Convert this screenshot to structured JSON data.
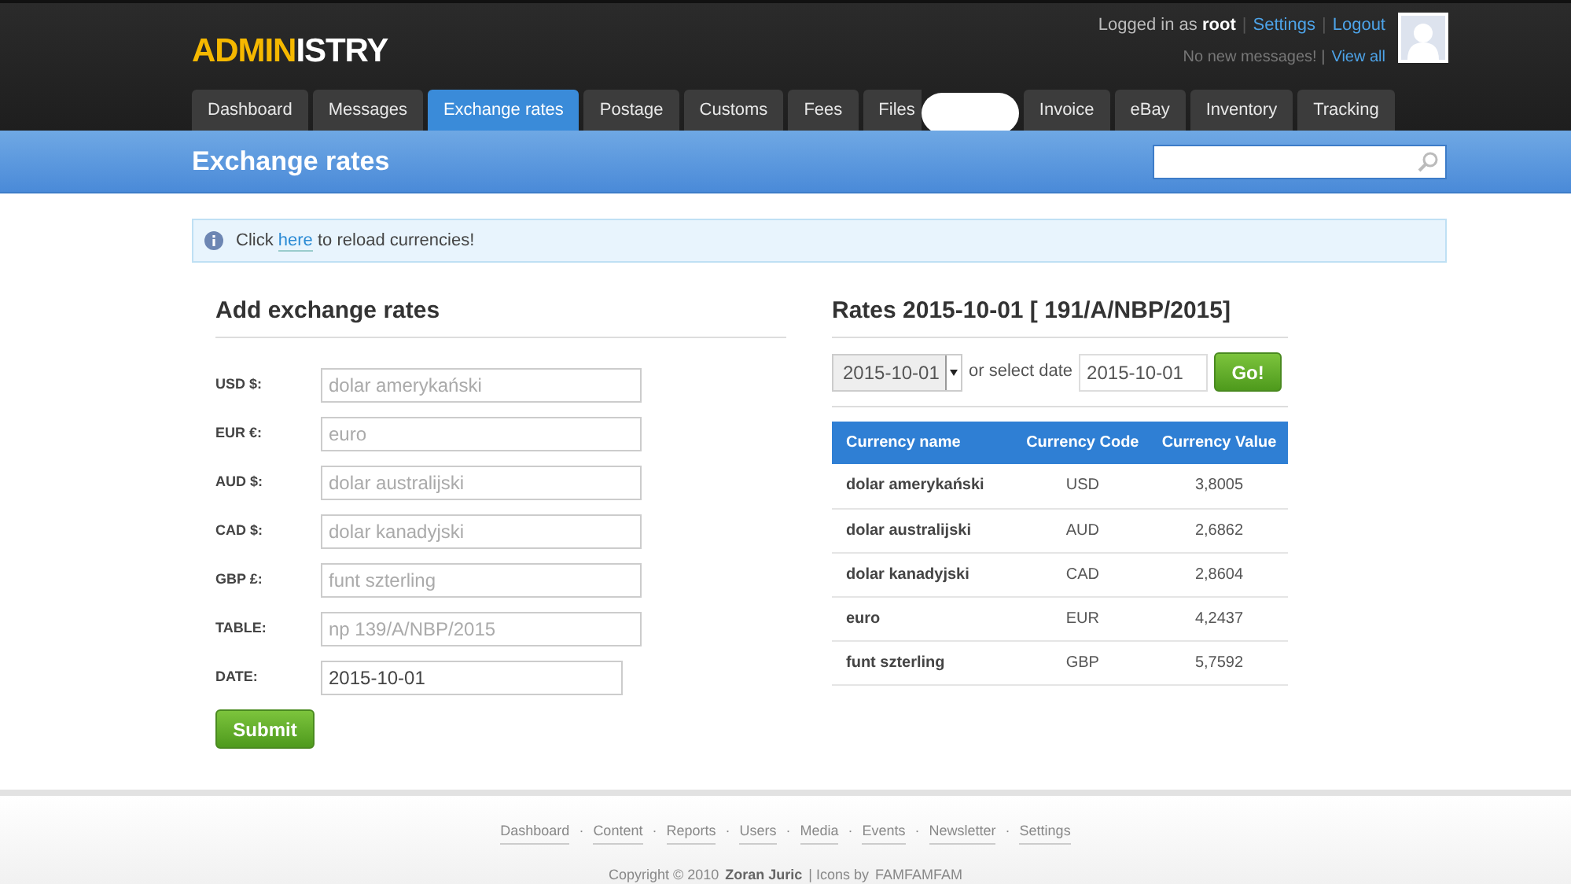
{
  "logo": {
    "part_1": "ADMIN",
    "part_2": "ISTRY"
  },
  "user_panel": {
    "logged_in_prefix": "Logged in as",
    "username": "root",
    "separator": "|",
    "settings_link": "Settings",
    "logout_link": "Logout",
    "messages_text": "No new messages! |",
    "view_all_link": "View all"
  },
  "tabs": [
    {
      "label": "Dashboard",
      "selected": false
    },
    {
      "label": "Messages",
      "selected": false
    },
    {
      "label": "Exchange rates",
      "selected": true
    },
    {
      "label": "Postage",
      "selected": false
    },
    {
      "label": "Customs",
      "selected": false
    },
    {
      "label": "Fees",
      "selected": false
    },
    {
      "label": "Files",
      "selected": false,
      "kind": "obscured"
    },
    {
      "label": "Invoice",
      "selected": false
    },
    {
      "label": "eBay",
      "selected": false
    },
    {
      "label": "Inventory",
      "selected": false
    },
    {
      "label": "Tracking",
      "selected": false
    }
  ],
  "page_title": "Exchange rates",
  "notice": {
    "before": "Click",
    "link": "here",
    "after": "to reload currencies!"
  },
  "add_form": {
    "title": "Add exchange rates",
    "fields": [
      {
        "label": "USD $:",
        "placeholder": "dolar amerykański"
      },
      {
        "label": "EUR €:",
        "placeholder": "euro"
      },
      {
        "label": "AUD $:",
        "placeholder": "dolar australijski"
      },
      {
        "label": "CAD $:",
        "placeholder": "dolar kanadyjski"
      },
      {
        "label": "GBP £:",
        "placeholder": "funt szterling"
      },
      {
        "label": "TABLE:",
        "placeholder": "np 139/A/NBP/2015"
      },
      {
        "label": "DATE:",
        "value": "2015-10-01"
      }
    ],
    "submit": "Submit"
  },
  "rates": {
    "title": "Rates 2015-10-01 [ 191/A/NBP/2015]",
    "date_select": "2015-10-01",
    "or_select_date": "or select date",
    "date_field": "2015-10-01",
    "go_button": "Go!",
    "table": {
      "columns": [
        "Currency name",
        "Currency Code",
        "Currency Value"
      ],
      "rows": [
        [
          "dolar amerykański",
          "USD",
          "3,8005"
        ],
        [
          "dolar australijski",
          "AUD",
          "2,6862"
        ],
        [
          "dolar kanadyjski",
          "CAD",
          "2,8604"
        ],
        [
          "euro",
          "EUR",
          "4,2437"
        ],
        [
          "funt szterling",
          "GBP",
          "5,7592"
        ]
      ]
    }
  },
  "footer": {
    "links": [
      "Dashboard",
      "Content",
      "Reports",
      "Users",
      "Media",
      "Events",
      "Newsletter",
      "Settings"
    ],
    "separator": "·",
    "copyright": "Copyright © 2010",
    "author": "Zoran Juric",
    "icons_by": "| Icons by",
    "icons_link": "FAMFAMFAM"
  }
}
